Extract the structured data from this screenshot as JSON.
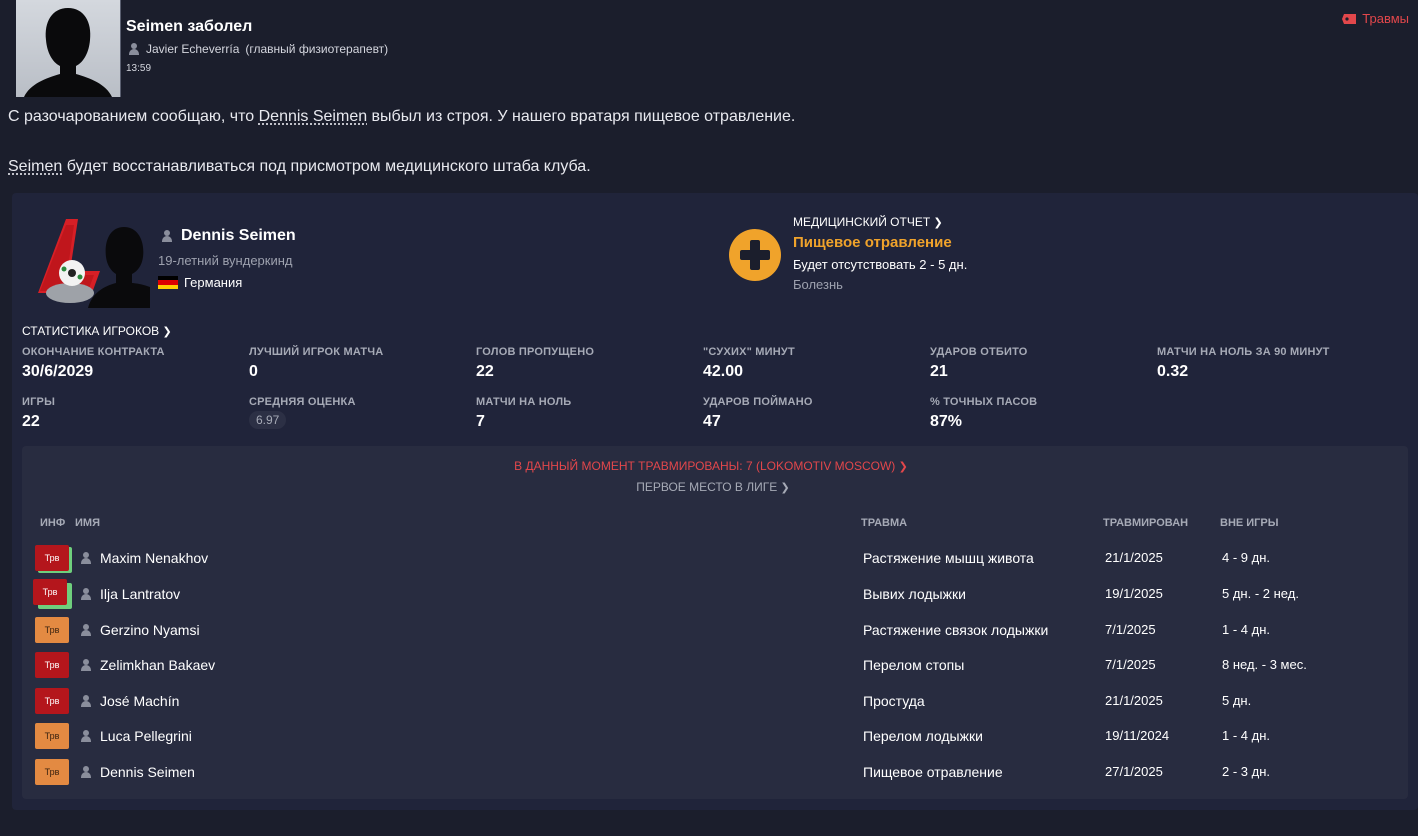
{
  "header": {
    "title": "Seimen заболел",
    "sender_name": "Javier Echeverría",
    "sender_role": "(главный физиотерапевт)",
    "time": "13:59",
    "tag": "Травмы"
  },
  "message": {
    "line1_before": "С разочарованием сообщаю, что ",
    "line1_link": "Dennis Seimen",
    "line1_after": " выбыл из строя. У нашего вратаря пищевое отравление.",
    "line2_link": "Seimen",
    "line2_after": " будет восстанавливаться под присмотром медицинского штаба клуба."
  },
  "player": {
    "name": "Dennis Seimen",
    "description": "19-летний вундеркинд",
    "nationality": "Германия"
  },
  "medical": {
    "heading": "МЕДИЦИНСКИЙ ОТЧЕТ",
    "diagnosis": "Пищевое отравление",
    "duration": "Будет отсутствовать 2 - 5 дн.",
    "type": "Болезнь"
  },
  "stats": {
    "heading": "СТАТИСТИКА ИГРОКОВ",
    "items": [
      {
        "label": "ОКОНЧАНИЕ КОНТРАКТА",
        "value": "30/6/2029"
      },
      {
        "label": "ЛУЧШИЙ ИГРОК МАТЧА",
        "value": "0"
      },
      {
        "label": "ГОЛОВ ПРОПУЩЕНО",
        "value": "22"
      },
      {
        "label": "\"СУХИХ\" МИНУТ",
        "value": "42.00"
      },
      {
        "label": "УДАРОВ ОТБИТО",
        "value": "21"
      },
      {
        "label": "МАТЧИ НА НОЛЬ ЗА 90 МИНУТ",
        "value": "0.32"
      },
      {
        "label": "ИГРЫ",
        "value": "22"
      },
      {
        "label": "СРЕДНЯЯ ОЦЕНКА",
        "value": "6.97"
      },
      {
        "label": "МАТЧИ НА НОЛЬ",
        "value": "7"
      },
      {
        "label": "УДАРОВ ПОЙМАНО",
        "value": "47"
      },
      {
        "label": "% ТОЧНЫХ ПАСОВ",
        "value": "87%"
      }
    ]
  },
  "injuries": {
    "headline": "В ДАННЫЙ МОМЕНТ ТРАВМИРОВАНЫ: 7 (LOKOMOTIV MOSCOW)",
    "league_line": "ПЕРВОЕ МЕСТО В ЛИГЕ",
    "columns": {
      "info": "ИНФ",
      "name": "ИМЯ",
      "injury": "ТРАВМА",
      "injured": "ТРАВМИРОВАН",
      "out": "ВНЕ ИГРЫ"
    },
    "badge_label": "Трв",
    "rows": [
      {
        "name": "Maxim Nenakhov",
        "injury": "Растяжение мышц живота",
        "date": "21/1/2025",
        "out": "4 - 9 дн.",
        "severity": "red",
        "color": "#b4161c"
      },
      {
        "name": "Ilja Lantratov",
        "injury": "Вывих лодыжки",
        "date": "19/1/2025",
        "out": "5 дн. - 2 нед.",
        "severity": "red",
        "color": "#b4161c"
      },
      {
        "name": "Gerzino Nyamsi",
        "injury": "Растяжение связок лодыжки",
        "date": "7/1/2025",
        "out": "1 - 4 дн.",
        "severity": "orange",
        "color": "#e38a42"
      },
      {
        "name": "Zelimkhan Bakaev",
        "injury": "Перелом стопы",
        "date": "7/1/2025",
        "out": "8 нед. - 3 мес.",
        "severity": "red",
        "color": "#b4161c"
      },
      {
        "name": "José Machín",
        "injury": "Простуда",
        "date": "21/1/2025",
        "out": "5 дн.",
        "severity": "red",
        "color": "#b4161c"
      },
      {
        "name": "Luca Pellegrini",
        "injury": "Перелом лодыжки",
        "date": "19/11/2024",
        "out": "1 - 4 дн.",
        "severity": "orange",
        "color": "#e38a42"
      },
      {
        "name": "Dennis Seimen",
        "injury": "Пищевое отравление",
        "date": "27/1/2025",
        "out": "2 - 3 дн.",
        "severity": "orange",
        "color": "#e38a42"
      }
    ]
  },
  "colors": {
    "background": "#1b1e2c",
    "panel": "#20243a",
    "accent_red": "#e2474b",
    "accent_orange": "#f0a32b"
  }
}
